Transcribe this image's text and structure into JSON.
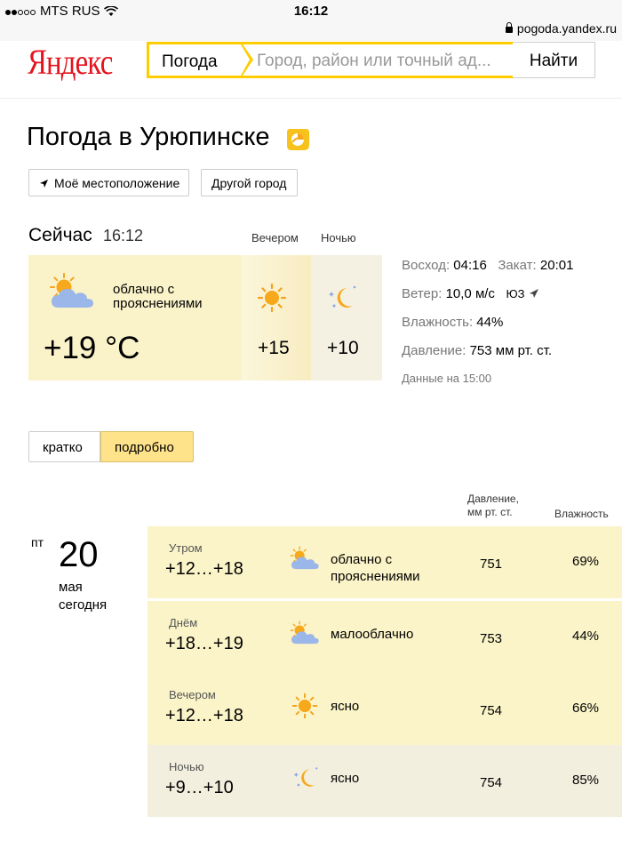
{
  "status_bar": {
    "carrier": "MTS RUS",
    "time": "16:12",
    "url": "pogoda.yandex.ru"
  },
  "header": {
    "logo": "Яндекс",
    "search_tab": "Погода",
    "search_placeholder": "Город, район или точный ад...",
    "search_button": "Найти"
  },
  "title": "Погода в Урюпинске",
  "buttons": {
    "my_location": "Моё местоположение",
    "other_city": "Другой город"
  },
  "now": {
    "label": "Сейчас",
    "time": "16:12",
    "condition": "облачно с прояснениями",
    "temp": "+19 °C",
    "evening_label": "Вечером",
    "night_label": "Ночью",
    "evening_temp": "+15",
    "night_temp": "+10"
  },
  "info": {
    "sunrise_label": "Восход:",
    "sunrise": "04:16",
    "sunset_label": "Закат:",
    "sunset": "20:01",
    "wind_label": "Ветер:",
    "wind": "10,0 м/с",
    "wind_dir": "ЮЗ",
    "humidity_label": "Влажность:",
    "humidity": "44%",
    "pressure_label": "Давление:",
    "pressure": "753 мм рт. ст.",
    "data_time": "Данные на 15:00"
  },
  "view_toggle": {
    "short": "кратко",
    "detailed": "подробно"
  },
  "table": {
    "pressure_header_1": "Давление,",
    "pressure_header_2": "мм рт. ст.",
    "humidity_header": "Влажность"
  },
  "day": {
    "weekday": "пт",
    "date": "20",
    "month": "мая",
    "relative": "сегодня"
  },
  "rows": [
    {
      "part": "Утром",
      "temp": "+12…+18",
      "condition": "облачно с прояснениями",
      "pressure": "751",
      "humidity": "69%",
      "icon": "partly-cloudy-icon"
    },
    {
      "part": "Днём",
      "temp": "+18…+19",
      "condition": "малооблачно",
      "pressure": "753",
      "humidity": "44%",
      "icon": "partly-cloudy-icon"
    },
    {
      "part": "Вечером",
      "temp": "+12…+18",
      "condition": "ясно",
      "pressure": "754",
      "humidity": "66%",
      "icon": "sun-icon"
    },
    {
      "part": "Ночью",
      "temp": "+9…+10",
      "condition": "ясно",
      "pressure": "754",
      "humidity": "85%",
      "icon": "moon-icon"
    }
  ],
  "colors": {
    "brand_red": "#e4131d",
    "accent_yellow": "#ffcc00",
    "now_bg": "#faf3c9"
  }
}
